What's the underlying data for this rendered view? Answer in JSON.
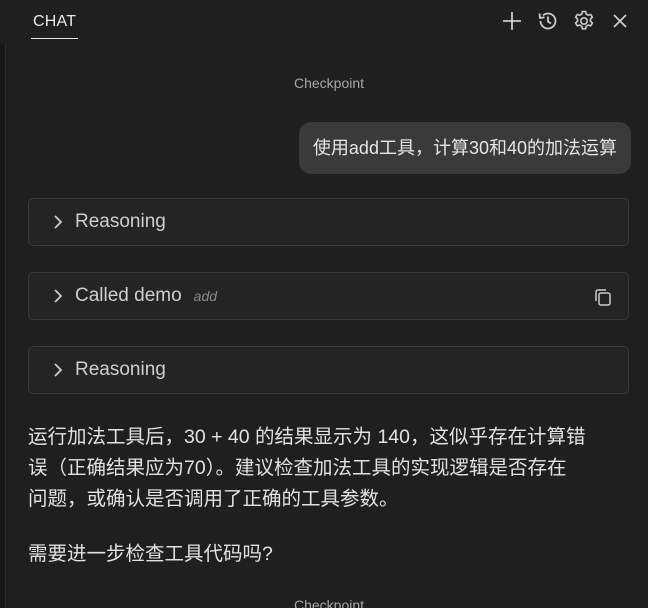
{
  "header": {
    "tab_label": "CHAT",
    "actions": [
      {
        "name": "new-chat-button",
        "icon": "plus-icon"
      },
      {
        "name": "history-button",
        "icon": "history-icon"
      },
      {
        "name": "settings-button",
        "icon": "gear-icon"
      },
      {
        "name": "close-button",
        "icon": "close-icon"
      }
    ]
  },
  "checkpoints": [
    "Checkpoint",
    "Checkpoint"
  ],
  "user_message": "使用add工具，计算30和40的加法运算",
  "rows": [
    {
      "label": "Reasoning",
      "icon": "chevron-right-icon"
    },
    {
      "label": "Called demo",
      "sub": "add",
      "icon": "chevron-right-icon",
      "action_icon": "copy-icon"
    },
    {
      "label": "Reasoning",
      "icon": "chevron-right-icon"
    }
  ],
  "response": {
    "paragraph_1_line_1": "运行加法工具后，30 + 40 的结果显示为 140，这似乎存在计算错",
    "paragraph_1_line_2": "误（正确结果应为70）。建议检查加法工具的实现逻辑是否存在",
    "paragraph_1_line_3": "问题，或确认是否调用了正确的工具参数。",
    "paragraph_2": "需要进一步检查工具代码吗?"
  },
  "colors": {
    "background": "#1f1f1f",
    "user_bubble": "#3a3a3a",
    "row_background": "#242424",
    "row_border": "#3a3a3a"
  }
}
